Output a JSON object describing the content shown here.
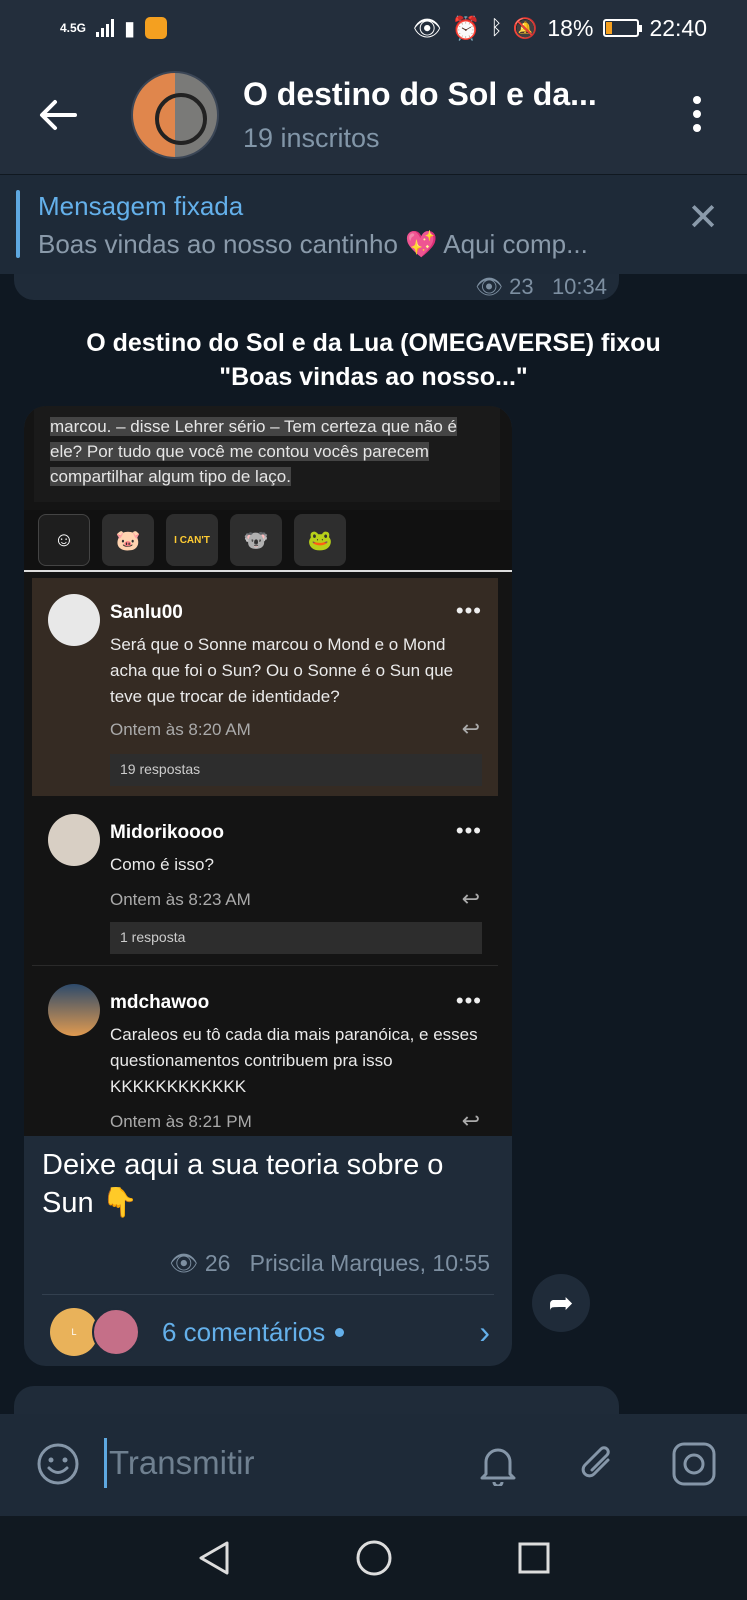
{
  "status_bar": {
    "network": "4.5G",
    "battery": "18%",
    "battery_level": 0.18,
    "time": "22:40"
  },
  "header": {
    "channel_name": "O destino do Sol e da...",
    "subscribers": "19 inscritos"
  },
  "pinned": {
    "title": "Mensagem fixada",
    "text": "Boas vindas ao nosso cantinho 💖  Aqui comp..."
  },
  "prev_message": {
    "views": "23",
    "time": "10:34"
  },
  "service_message": {
    "line1": "O destino do Sol e da Lua (OMEGAVERSE) fixou",
    "line2": "\"Boas vindas ao nosso...\""
  },
  "screenshot": {
    "story_text": "marcou. – disse Lehrer sério – Tem certeza que não é ele? Por tudo que você me contou vocês parecem compartilhar algum tipo de laço.",
    "sticker_label": "I CAN'T",
    "comments": [
      {
        "user": "Sanlu00",
        "text": "Será que o Sonne marcou o Mond e o Mond acha que foi o Sun? Ou o Sonne é o Sun que teve que trocar de identidade?",
        "date": "Ontem às 8:20 AM",
        "replies": "19 respostas"
      },
      {
        "user": "Midorikoooo",
        "text": "Como é isso?",
        "date": "Ontem às 8:23 AM",
        "replies": "1 resposta"
      },
      {
        "user": "mdchawoo",
        "text": "Caraleos eu tô cada dia mais paranóica, e esses questionamentos contribuem pra isso KKKKKKKKKKKK",
        "date": "Ontem às 8:21 PM"
      }
    ]
  },
  "message": {
    "caption": "Deixe aqui a sua teoria sobre o Sun 👇",
    "views": "26",
    "author_time": "Priscila Marques, 10:55",
    "comments_label": "6 comentários",
    "comment_avatar_letter": "L"
  },
  "input": {
    "placeholder": "Transmitir"
  },
  "colors": {
    "background": "#17212b",
    "header": "#232e3c",
    "accent": "#64b0ea",
    "bubble": "#1f2b39"
  }
}
